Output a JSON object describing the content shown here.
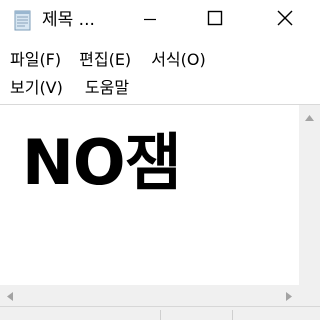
{
  "window": {
    "title": "제목 ...",
    "icon": "notepad-icon",
    "controls": {
      "minimize_icon": "minimize-icon",
      "maximize_icon": "maximize-icon",
      "close_icon": "close-icon"
    }
  },
  "menu": {
    "items": [
      {
        "label": "파일(F)"
      },
      {
        "label": "편집(E)"
      },
      {
        "label": "서식(O)"
      },
      {
        "label": "보기(V)"
      },
      {
        "label": "도움말"
      }
    ]
  },
  "editor": {
    "content": "NO잼"
  },
  "scrollbars": {
    "up_icon": "chevron-up-icon",
    "left_icon": "chevron-left-icon",
    "right_icon": "chevron-right-icon"
  },
  "colors": {
    "background": "#ffffff",
    "chrome": "#f0f0f0",
    "text": "#000000"
  }
}
